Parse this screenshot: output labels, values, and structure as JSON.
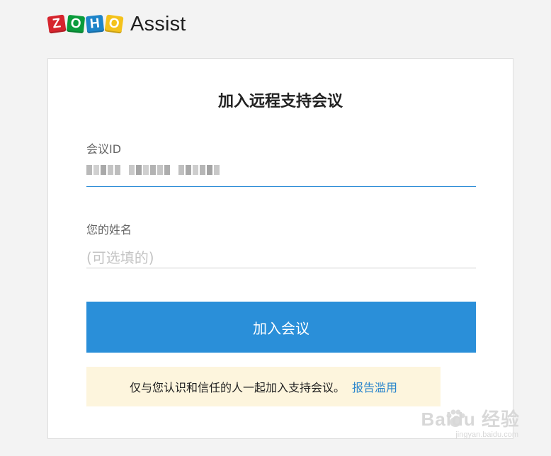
{
  "header": {
    "logo_letters": [
      "Z",
      "O",
      "H",
      "O"
    ],
    "logo_colors": [
      "#d6242d",
      "#0a9b3b",
      "#1d84c9",
      "#f4c21b"
    ],
    "product_name": "Assist"
  },
  "form": {
    "title": "加入远程支持会议",
    "meeting_id_label": "会议ID",
    "meeting_id_value": "(blurred)",
    "name_label": "您的姓名",
    "name_placeholder": "(可选填的)",
    "join_button_label": "加入会议"
  },
  "notice": {
    "text": "仅与您认识和信任的人一起加入支持会议。",
    "link_label": "报告滥用"
  },
  "watermark": {
    "main": "Baidu 经验",
    "sub": "jingyan.baidu.com"
  },
  "colors": {
    "accent": "#2a8fd9",
    "notice_bg": "#fdf5dd",
    "link": "#2a85cc"
  }
}
